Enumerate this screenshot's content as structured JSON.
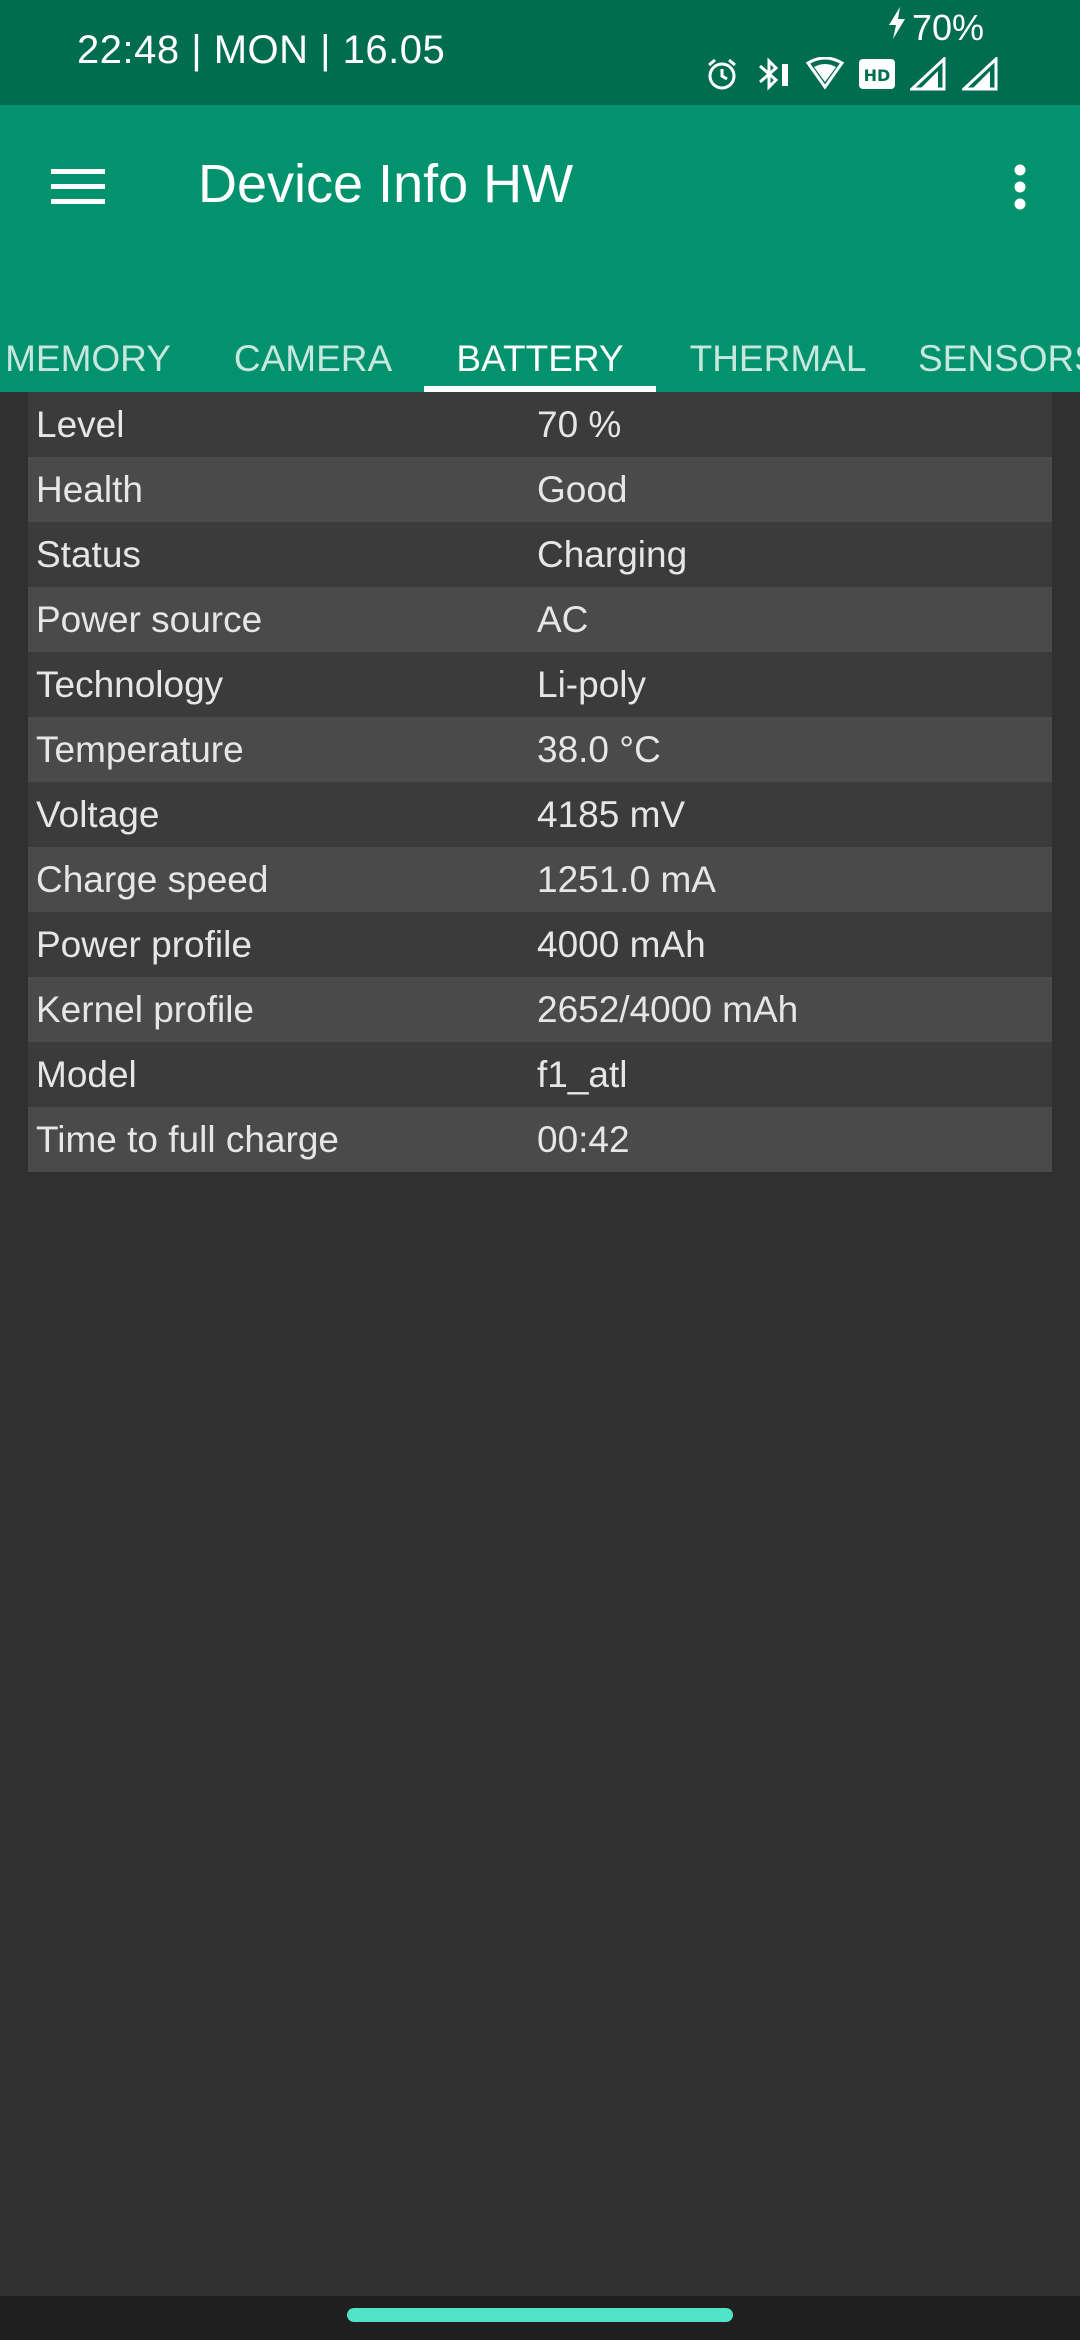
{
  "status_bar": {
    "time": "22:48 | MON | 16.05",
    "battery": "70%",
    "icons": [
      "charging-bolt-icon",
      "alarm-icon",
      "bluetooth-icon",
      "wifi-icon",
      "hd-icon",
      "signal-icon",
      "signal-icon"
    ]
  },
  "app_bar": {
    "title": "Device Info HW",
    "background": "#02926d"
  },
  "tabs": [
    {
      "label": "MEMORY"
    },
    {
      "label": "CAMERA"
    },
    {
      "label": "BATTERY",
      "active": true
    },
    {
      "label": "THERMAL"
    },
    {
      "label": "SENSORS"
    }
  ],
  "battery_info": [
    {
      "label": "Level",
      "value": "70 %"
    },
    {
      "label": "Health",
      "value": "Good"
    },
    {
      "label": "Status",
      "value": "Charging"
    },
    {
      "label": "Power source",
      "value": "AC"
    },
    {
      "label": "Technology",
      "value": "Li-poly"
    },
    {
      "label": "Temperature",
      "value": "38.0 °C"
    },
    {
      "label": "Voltage",
      "value": "4185 mV"
    },
    {
      "label": "Charge speed",
      "value": "1251.0 mA"
    },
    {
      "label": "Power profile",
      "value": "4000 mAh"
    },
    {
      "label": "Kernel profile",
      "value": "2652/4000 mAh"
    },
    {
      "label": "Model",
      "value": "f1_atl"
    },
    {
      "label": "Time to full charge",
      "value": "00:42"
    }
  ],
  "colors": {
    "status_bar": "#006d50",
    "accent": "#02926d",
    "background": "#303030",
    "home_indicator": "#4fe3c7"
  }
}
